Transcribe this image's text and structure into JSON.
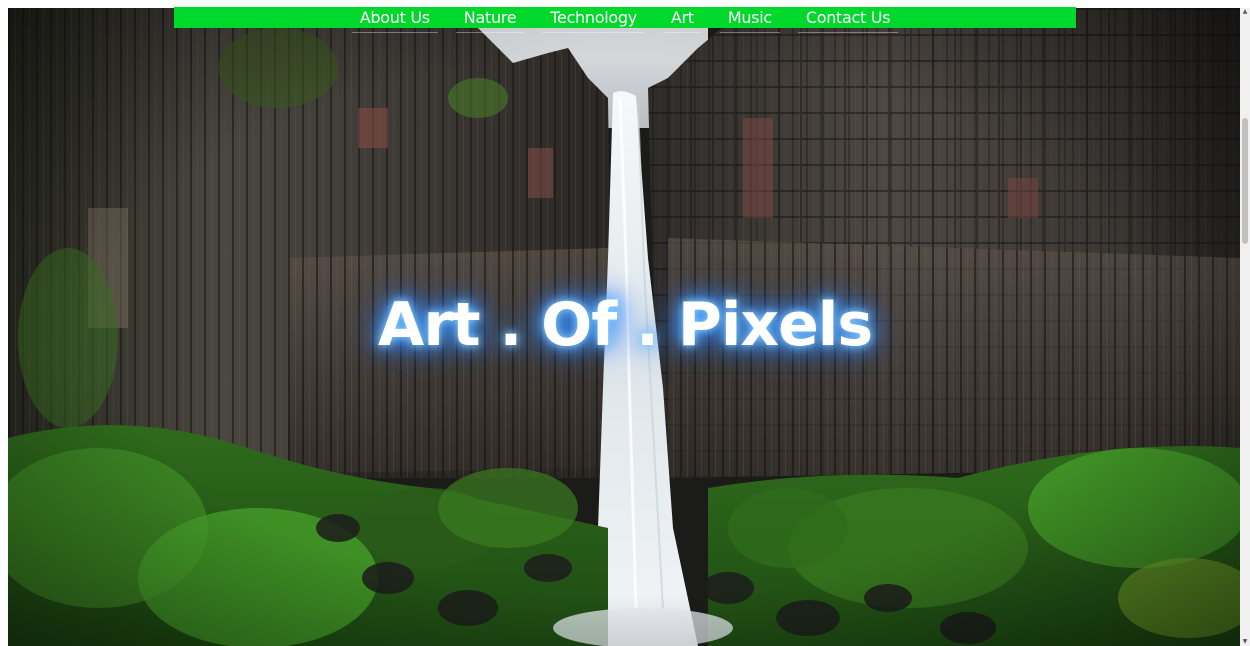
{
  "nav": {
    "items": [
      {
        "label": "About Us"
      },
      {
        "label": "Nature"
      },
      {
        "label": "Technology"
      },
      {
        "label": "Art"
      },
      {
        "label": "Music"
      },
      {
        "label": "Contact Us"
      }
    ]
  },
  "hero": {
    "title": "Art . Of . Pixels"
  },
  "colors": {
    "nav_background": "#00d82c",
    "title_glow": "#2b84ff",
    "title_text": "#ffffff"
  },
  "icons": {
    "scroll_up": "triangle-up",
    "scroll_down": "triangle-down"
  }
}
